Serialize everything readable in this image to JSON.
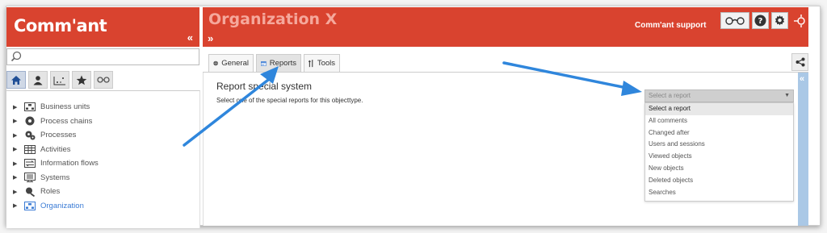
{
  "header": {
    "logo_text": "Comm'ant",
    "collapse_left": "«",
    "org_title": "Organization X",
    "expand_right": "»",
    "support_label": "Comm'ant support",
    "icons": [
      "glasses-icon",
      "help-icon",
      "settings-icon",
      "logout-icon"
    ],
    "help_glyph": "?"
  },
  "search": {
    "placeholder": ""
  },
  "left_tabs": [
    "home-icon",
    "users-icon",
    "numbers-icon",
    "star-icon",
    "links-icon"
  ],
  "tree": [
    {
      "label": "Business units",
      "icon": "org-chart-icon"
    },
    {
      "label": "Process chains",
      "icon": "gear-chain-icon"
    },
    {
      "label": "Processes",
      "icon": "gears-icon"
    },
    {
      "label": "Activities",
      "icon": "table-icon"
    },
    {
      "label": "Information flows",
      "icon": "flow-icon"
    },
    {
      "label": "Systems",
      "icon": "server-icon"
    },
    {
      "label": "Roles",
      "icon": "role-icon"
    },
    {
      "label": "Organization",
      "icon": "organization-icon",
      "selected": true
    }
  ],
  "tabs": [
    {
      "label": "General",
      "icon": "cube-icon"
    },
    {
      "label": "Reports",
      "icon": "report-icon",
      "active": true
    },
    {
      "label": "Tools",
      "icon": "tools-icon"
    }
  ],
  "right_collapse": "«",
  "report": {
    "title": "Report special system",
    "description": "Select one of the special reports for this objecttype."
  },
  "select": {
    "placeholder": "Select a report",
    "options": [
      "Select a report",
      "All comments",
      "Changed after",
      "Users and sessions",
      "Viewed objects",
      "New objects",
      "Deleted objects",
      "Searches"
    ]
  },
  "colors": {
    "brand": "#d9432f",
    "accent": "#3a7bd5",
    "arrow": "#3d8fe0"
  }
}
